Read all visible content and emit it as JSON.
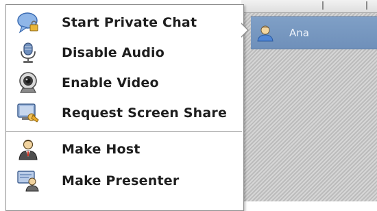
{
  "attendee": {
    "name": "Ana",
    "icon": "user-icon"
  },
  "menu": {
    "items": [
      {
        "label": "Start Private Chat",
        "icon": "chat-bubble-icon"
      },
      {
        "label": "Disable Audio",
        "icon": "microphone-icon"
      },
      {
        "label": "Enable Video",
        "icon": "webcam-icon"
      },
      {
        "label": "Request Screen Share",
        "icon": "screen-share-icon"
      },
      {
        "label": "Make Host",
        "icon": "host-icon"
      },
      {
        "label": "Make Presenter",
        "icon": "presenter-icon"
      }
    ]
  },
  "colors": {
    "attendee_highlight": "#7896be",
    "menu_text": "#1e1e1e",
    "icon_blue": "#5b84c4"
  }
}
